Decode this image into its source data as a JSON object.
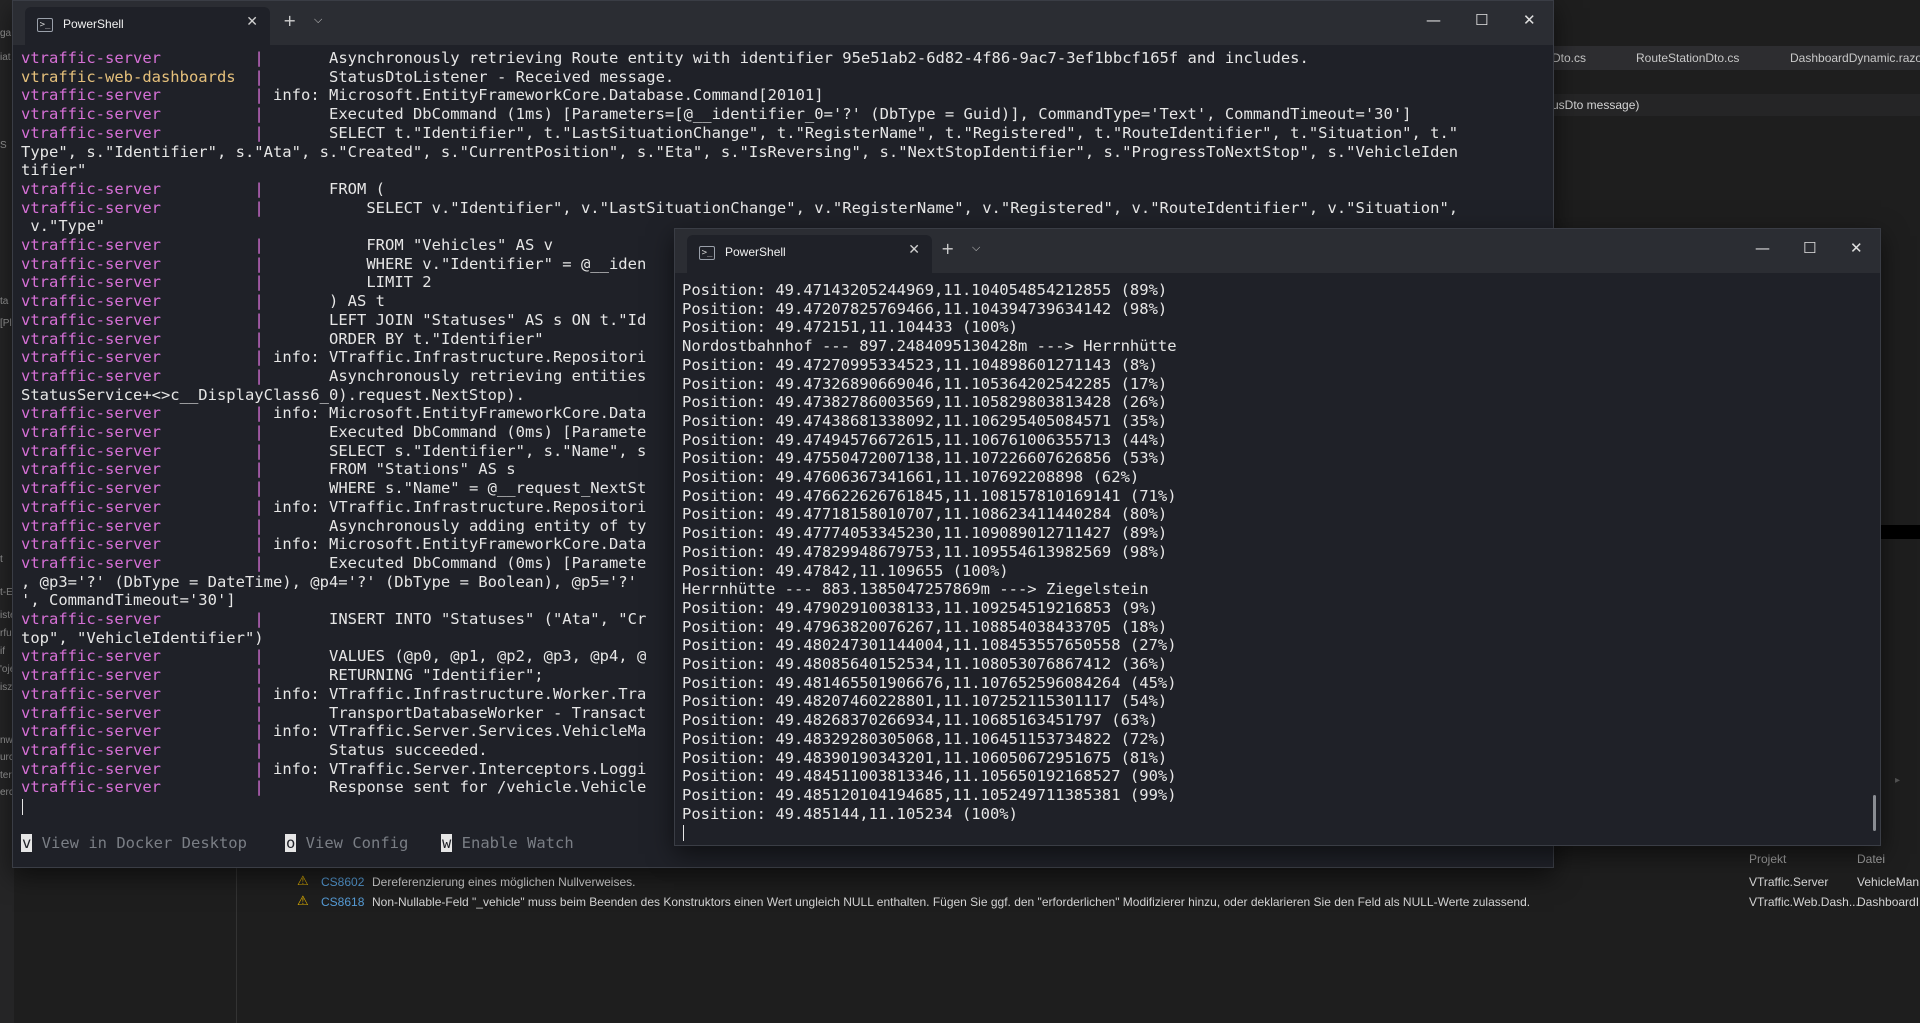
{
  "ide": {
    "file_tabs": [
      "Dto.cs",
      "RouteStationDto.cs",
      "DashboardDynamic.razor"
    ],
    "signature_hint": "usDto message)",
    "error_list": {
      "col_project": "Projekt",
      "col_file": "Datei",
      "rows": [
        {
          "code": "CS8602",
          "description": "Dereferenzierung eines möglichen Nullverweises.",
          "project": "VTraffic.Server",
          "file": "VehicleMan"
        },
        {
          "code": "CS8618",
          "description": "Non-Nullable-Feld \"_vehicle\" muss beim Beenden des Konstruktors einen Wert ungleich NULL enthalten. Fügen Sie ggf. den \"erforderlichen\" Modifizierer hinzu, oder deklarieren Sie den Feld als NULL-Werte zulassend.",
          "project": "VTraffic.Web.Dash...",
          "file": "DashboardI"
        }
      ]
    },
    "left_fragments": [
      "ga",
      "iat",
      "S",
      "ta",
      "[Pl",
      "t",
      "iste",
      "rfu",
      "if",
      "'oje",
      "isz",
      "nw",
      "urc",
      "ter",
      "erc",
      "t-E"
    ]
  },
  "window_left": {
    "tab_title": "PowerShell",
    "icon": "powershell-icon",
    "lines": [
      {
        "svc": "vtraffic-server",
        "sep": "|",
        "msg": "      Asynchronously retrieving Route entity with identifier 95e51ab2-6d82-4f86-9ac7-3ef1bbcf165f and includes."
      },
      {
        "svc": "vtraffic-web-dashboards",
        "sep": "|",
        "msg": "      StatusDtoListener - Received message.",
        "alt": true
      },
      {
        "svc": "vtraffic-server",
        "sep": "|",
        "msg": "info: Microsoft.EntityFrameworkCore.Database.Command[20101]"
      },
      {
        "svc": "vtraffic-server",
        "sep": "|",
        "msg": "      Executed DbCommand (1ms) [Parameters=[@__identifier_0='?' (DbType = Guid)], CommandType='Text', CommandTimeout='30']"
      },
      {
        "svc": "vtraffic-server",
        "sep": "|",
        "msg": "      SELECT t.\"Identifier\", t.\"LastSituationChange\", t.\"RegisterName\", t.\"Registered\", t.\"RouteIdentifier\", t.\"Situation\", t.\""
      },
      {
        "raw": "Type\", s.\"Identifier\", s.\"Ata\", s.\"Created\", s.\"CurrentPosition\", s.\"Eta\", s.\"IsReversing\", s.\"NextStopIdentifier\", s.\"ProgressToNextStop\", s.\"VehicleIden"
      },
      {
        "raw": "tifier\""
      },
      {
        "svc": "vtraffic-server",
        "sep": "|",
        "msg": "      FROM ("
      },
      {
        "svc": "vtraffic-server",
        "sep": "|",
        "msg": "          SELECT v.\"Identifier\", v.\"LastSituationChange\", v.\"RegisterName\", v.\"Registered\", v.\"RouteIdentifier\", v.\"Situation\","
      },
      {
        "raw": " v.\"Type\""
      },
      {
        "svc": "vtraffic-server",
        "sep": "|",
        "msg": "          FROM \"Vehicles\" AS v"
      },
      {
        "svc": "vtraffic-server",
        "sep": "|",
        "msg": "          WHERE v.\"Identifier\" = @__iden"
      },
      {
        "svc": "vtraffic-server",
        "sep": "|",
        "msg": "          LIMIT 2"
      },
      {
        "svc": "vtraffic-server",
        "sep": "|",
        "msg": "      ) AS t"
      },
      {
        "svc": "vtraffic-server",
        "sep": "|",
        "msg": "      LEFT JOIN \"Statuses\" AS s ON t.\"Id"
      },
      {
        "svc": "vtraffic-server",
        "sep": "|",
        "msg": "      ORDER BY t.\"Identifier\""
      },
      {
        "svc": "vtraffic-server",
        "sep": "|",
        "msg": "info: VTraffic.Infrastructure.Repositori"
      },
      {
        "svc": "vtraffic-server",
        "sep": "|",
        "msg": "      Asynchronously retrieving entities"
      },
      {
        "raw": "StatusService+<>c__DisplayClass6_0).request.NextStop)."
      },
      {
        "svc": "vtraffic-server",
        "sep": "|",
        "msg": "info: Microsoft.EntityFrameworkCore.Data"
      },
      {
        "svc": "vtraffic-server",
        "sep": "|",
        "msg": "      Executed DbCommand (0ms) [Paramete"
      },
      {
        "svc": "vtraffic-server",
        "sep": "|",
        "msg": "      SELECT s.\"Identifier\", s.\"Name\", s"
      },
      {
        "svc": "vtraffic-server",
        "sep": "|",
        "msg": "      FROM \"Stations\" AS s"
      },
      {
        "svc": "vtraffic-server",
        "sep": "|",
        "msg": "      WHERE s.\"Name\" = @__request_NextSt"
      },
      {
        "svc": "vtraffic-server",
        "sep": "|",
        "msg": "info: VTraffic.Infrastructure.Repositori"
      },
      {
        "svc": "vtraffic-server",
        "sep": "|",
        "msg": "      Asynchronously adding entity of ty"
      },
      {
        "svc": "vtraffic-server",
        "sep": "|",
        "msg": "info: Microsoft.EntityFrameworkCore.Data"
      },
      {
        "svc": "vtraffic-server",
        "sep": "|",
        "msg": "      Executed DbCommand (0ms) [Paramete"
      },
      {
        "raw": ", @p3='?' (DbType = DateTime), @p4='?' (DbType = Boolean), @p5='?'"
      },
      {
        "raw": "', CommandTimeout='30']"
      },
      {
        "svc": "vtraffic-server",
        "sep": "|",
        "msg": "      INSERT INTO \"Statuses\" (\"Ata\", \"Cr"
      },
      {
        "raw": "top\", \"VehicleIdentifier\")"
      },
      {
        "svc": "vtraffic-server",
        "sep": "|",
        "msg": "      VALUES (@p0, @p1, @p2, @p3, @p4, @"
      },
      {
        "svc": "vtraffic-server",
        "sep": "|",
        "msg": "      RETURNING \"Identifier\";"
      },
      {
        "svc": "vtraffic-server",
        "sep": "|",
        "msg": "info: VTraffic.Infrastructure.Worker.Tra"
      },
      {
        "svc": "vtraffic-server",
        "sep": "|",
        "msg": "      TransportDatabaseWorker - Transact"
      },
      {
        "svc": "vtraffic-server",
        "sep": "|",
        "msg": "info: VTraffic.Server.Services.VehicleMa"
      },
      {
        "svc": "vtraffic-server",
        "sep": "|",
        "msg": "      Status succeeded."
      },
      {
        "svc": "vtraffic-server",
        "sep": "|",
        "msg": "info: VTraffic.Server.Interceptors.Loggi"
      },
      {
        "svc": "vtraffic-server",
        "sep": "|",
        "msg": "      Response sent for /vehicle.Vehicle"
      }
    ],
    "footer": [
      {
        "key": "v",
        "label": " View in Docker Desktop"
      },
      {
        "key": "o",
        "label": " View Config"
      },
      {
        "key": "w",
        "label": " Enable Watch"
      }
    ]
  },
  "window_right": {
    "tab_title": "PowerShell",
    "icon": "powershell-icon",
    "lines": [
      "Position: 49.47143205244969,11.104054854212855 (89%)",
      "Position: 49.47207825769466,11.104394739634142 (98%)",
      "Position: 49.472151,11.104433 (100%)",
      "Nordostbahnhof --- 897.2484095130428m ---> Herrnhütte",
      "Position: 49.47270995334523,11.104898601271143 (8%)",
      "Position: 49.47326890669046,11.105364202542285 (17%)",
      "Position: 49.47382786003569,11.105829803813428 (26%)",
      "Position: 49.47438681338092,11.106295405084571 (35%)",
      "Position: 49.47494576672615,11.106761006355713 (44%)",
      "Position: 49.47550472007138,11.107226607626856 (53%)",
      "Position: 49.47606367341661,11.107692208898 (62%)",
      "Position: 49.476622626761845,11.108157810169141 (71%)",
      "Position: 49.47718158010707,11.108623411440284 (80%)",
      "Position: 49.47774053345230,11.109089012711427 (89%)",
      "Position: 49.47829948679753,11.109554613982569 (98%)",
      "Position: 49.47842,11.109655 (100%)",
      "Herrnhütte --- 883.1385047257869m ---> Ziegelstein",
      "Position: 49.47902910038133,11.109254519216853 (9%)",
      "Position: 49.47963820076267,11.108854038433705 (18%)",
      "Position: 49.480247301144004,11.108453557650558 (27%)",
      "Position: 49.48085640152534,11.108053076867412 (36%)",
      "Position: 49.481465501906676,11.107652596084264 (45%)",
      "Position: 49.48207460228801,11.107252115301117 (54%)",
      "Position: 49.48268370266934,11.10685163451797 (63%)",
      "Position: 49.48329280305068,11.106451153734822 (72%)",
      "Position: 49.48390190343201,11.106050672951675 (81%)",
      "Position: 49.484511003813346,11.105650192168527 (90%)",
      "Position: 49.485120104194685,11.105249711385381 (99%)",
      "Position: 49.485144,11.105234 (100%)"
    ]
  },
  "colors": {
    "service": "#d670d6",
    "service_alt": "#e5c07b",
    "text": "#e6e6e6",
    "terminal_bg": "#1f2128",
    "titlebar_bg": "#2b2d33"
  }
}
